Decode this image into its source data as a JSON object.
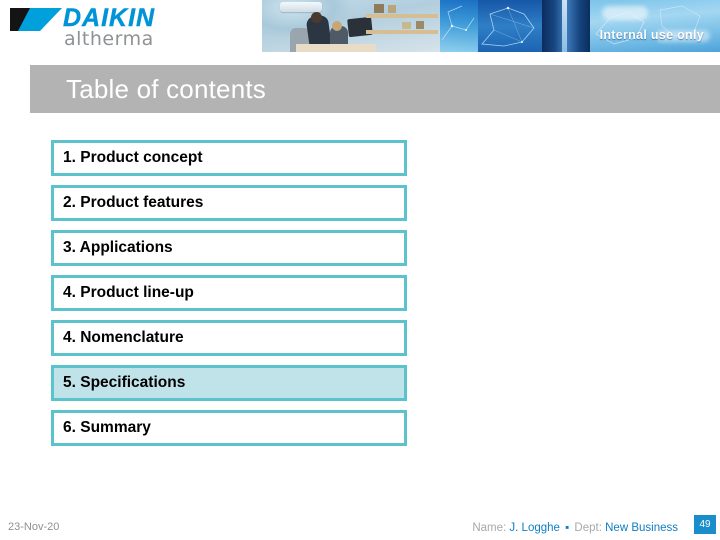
{
  "header": {
    "logo_brand": "DAIKIN",
    "logo_product": "altherma",
    "confidentiality": "Internal use only"
  },
  "slide": {
    "title": "Table of contents"
  },
  "toc": {
    "items": [
      {
        "label": "1. Product concept",
        "highlighted": false
      },
      {
        "label": "2. Product features",
        "highlighted": false
      },
      {
        "label": "3. Applications",
        "highlighted": false
      },
      {
        "label": "4. Product line-up",
        "highlighted": false
      },
      {
        "label": "4. Nomenclature",
        "highlighted": false
      },
      {
        "label": "5. Specifications",
        "highlighted": true
      },
      {
        "label": "6. Summary",
        "highlighted": false
      }
    ]
  },
  "footer": {
    "date": "23-Nov-20",
    "name_label": "Name:",
    "name_value": "J. Logghe",
    "separator": "▪",
    "dept_label": "Dept:",
    "dept_value": "New Business",
    "page_number": "49"
  },
  "colors": {
    "accent_teal": "#5cc3cc",
    "accent_teal_fill": "#c0e3e9",
    "title_bar_gray": "#b3b3b3",
    "brand_blue": "#0093d8",
    "footer_blue": "#0e7ec4",
    "page_badge_blue": "#1a8ecb"
  }
}
